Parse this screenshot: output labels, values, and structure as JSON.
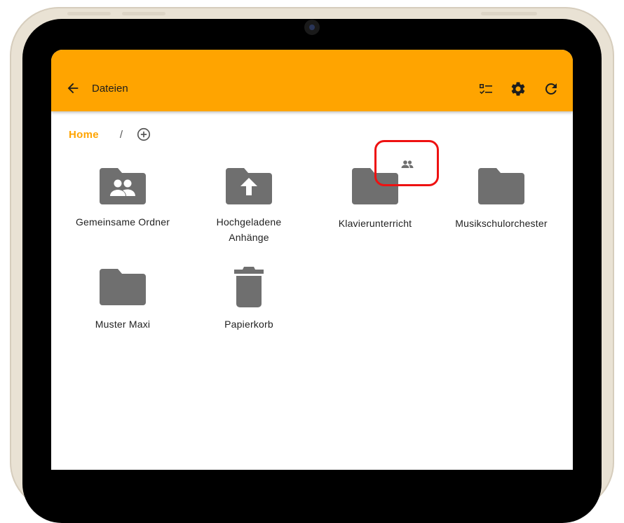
{
  "appbar": {
    "title": "Dateien",
    "bg_color": "#ffa400",
    "actions": [
      {
        "icon": "checklist-icon"
      },
      {
        "icon": "gear-icon"
      },
      {
        "icon": "refresh-icon"
      }
    ]
  },
  "breadcrumb": {
    "home": "Home",
    "separator": "/"
  },
  "items": [
    {
      "label": "Gemeinsame Ordner",
      "icon": "shared-folder-icon"
    },
    {
      "label": "Hochgeladene Anhänge",
      "icon": "upload-folder-icon"
    },
    {
      "label": "Klavierunterricht",
      "icon": "folder-icon",
      "shared": true
    },
    {
      "label": "Musikschulorchester",
      "icon": "folder-icon"
    },
    {
      "label": "Muster Maxi",
      "icon": "folder-icon"
    },
    {
      "label": "Papierkorb",
      "icon": "trash-icon"
    }
  ],
  "colors": {
    "accent": "#ffa400",
    "icon_grey": "#6f6f6f",
    "highlight": "#ee1111"
  }
}
